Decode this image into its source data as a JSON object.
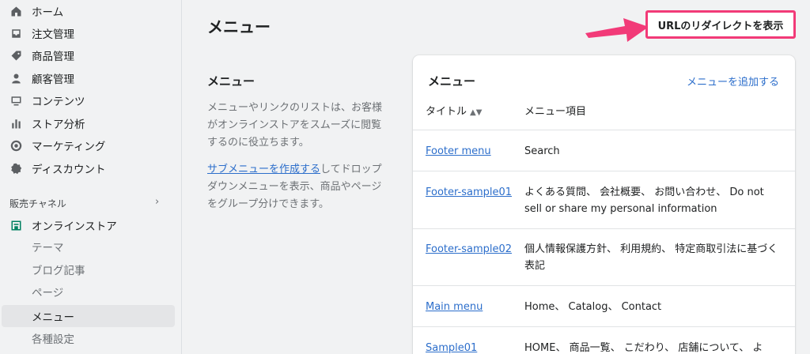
{
  "sidebar": {
    "items": [
      {
        "label": "ホーム",
        "icon": "home-icon"
      },
      {
        "label": "注文管理",
        "icon": "inbox-icon"
      },
      {
        "label": "商品管理",
        "icon": "tag-icon"
      },
      {
        "label": "顧客管理",
        "icon": "person-icon"
      },
      {
        "label": "コンテンツ",
        "icon": "content-icon"
      },
      {
        "label": "ストア分析",
        "icon": "bar-chart-icon"
      },
      {
        "label": "マーケティング",
        "icon": "target-icon"
      },
      {
        "label": "ディスカウント",
        "icon": "discount-icon"
      }
    ],
    "channels_label": "販売チャネル",
    "online_store_label": "オンラインストア",
    "sub_items": [
      "テーマ",
      "ブログ記事",
      "ページ",
      "メニュー",
      "各種設定"
    ]
  },
  "main": {
    "page_title": "メニュー",
    "redirect_button": "URLのリダイレクトを表示",
    "section_heading": "メニュー",
    "section_desc": "メニューやリンクのリストは、お客様がオンラインストアをスムーズに閲覧するのに役立ちます。",
    "submenu_link": "サブメニューを作成する",
    "submenu_rest": "してドロップダウンメニューを表示、商品やページをグループ分けできます。"
  },
  "card": {
    "title": "メニュー",
    "add_link": "メニューを追加する",
    "col_title": "タイトル",
    "col_items": "メニュー項目",
    "rows": [
      {
        "title": "Footer menu",
        "items": "Search"
      },
      {
        "title": "Footer-sample01",
        "items": "よくある質問、 会社概要、 お問い合わせ、 Do not sell or share my personal information"
      },
      {
        "title": "Footer-sample02",
        "items": "個人情報保護方針、 利用規約、 特定商取引法に基づく表記"
      },
      {
        "title": "Main menu",
        "items": "Home、 Catalog、 Contact"
      },
      {
        "title": "Sample01",
        "items": "HOME、 商品一覧、 こだわり、 店舗について、 よ"
      }
    ]
  },
  "colors": {
    "accent": "#2c6ecb",
    "highlight": "#f23a78"
  }
}
